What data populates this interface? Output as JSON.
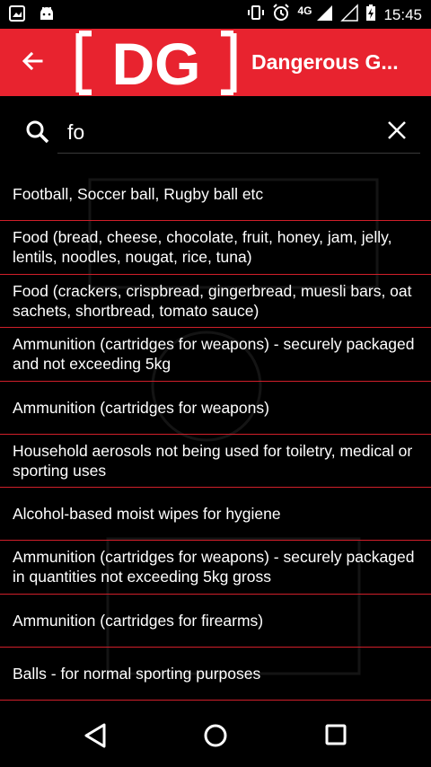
{
  "status_bar": {
    "network": "4G",
    "time": "15:45"
  },
  "app_bar": {
    "logo_text": "DG",
    "title": "Dangerous G..."
  },
  "search": {
    "value": "fo"
  },
  "results": [
    "Football, Soccer ball, Rugby ball etc",
    "Food (bread, cheese, chocolate, fruit, honey, jam, jelly, lentils, noodles, nougat, rice, tuna)",
    "Food (crackers, crispbread, gingerbread, muesli bars, oat sachets, shortbread, tomato sauce)",
    "Ammunition (cartridges for weapons) - securely packaged and not exceeding 5kg",
    "Ammunition (cartridges for weapons)",
    "Household aerosols not being used for toiletry, medical or sporting uses",
    "Alcohol-based moist wipes for hygiene",
    "Ammunition (cartridges for weapons) - securely packaged in quantities not exceeding 5kg gross",
    "Ammunition (cartridges for firearms)",
    "Balls - for normal sporting purposes"
  ],
  "colors": {
    "accent": "#e8232f",
    "divider": "#d01f2a",
    "background": "#000000"
  },
  "icons": {
    "back": "arrow-left-icon",
    "search": "search-icon",
    "clear": "close-icon",
    "nav_back": "triangle-back-icon",
    "nav_home": "circle-home-icon",
    "nav_recents": "square-recents-icon"
  }
}
